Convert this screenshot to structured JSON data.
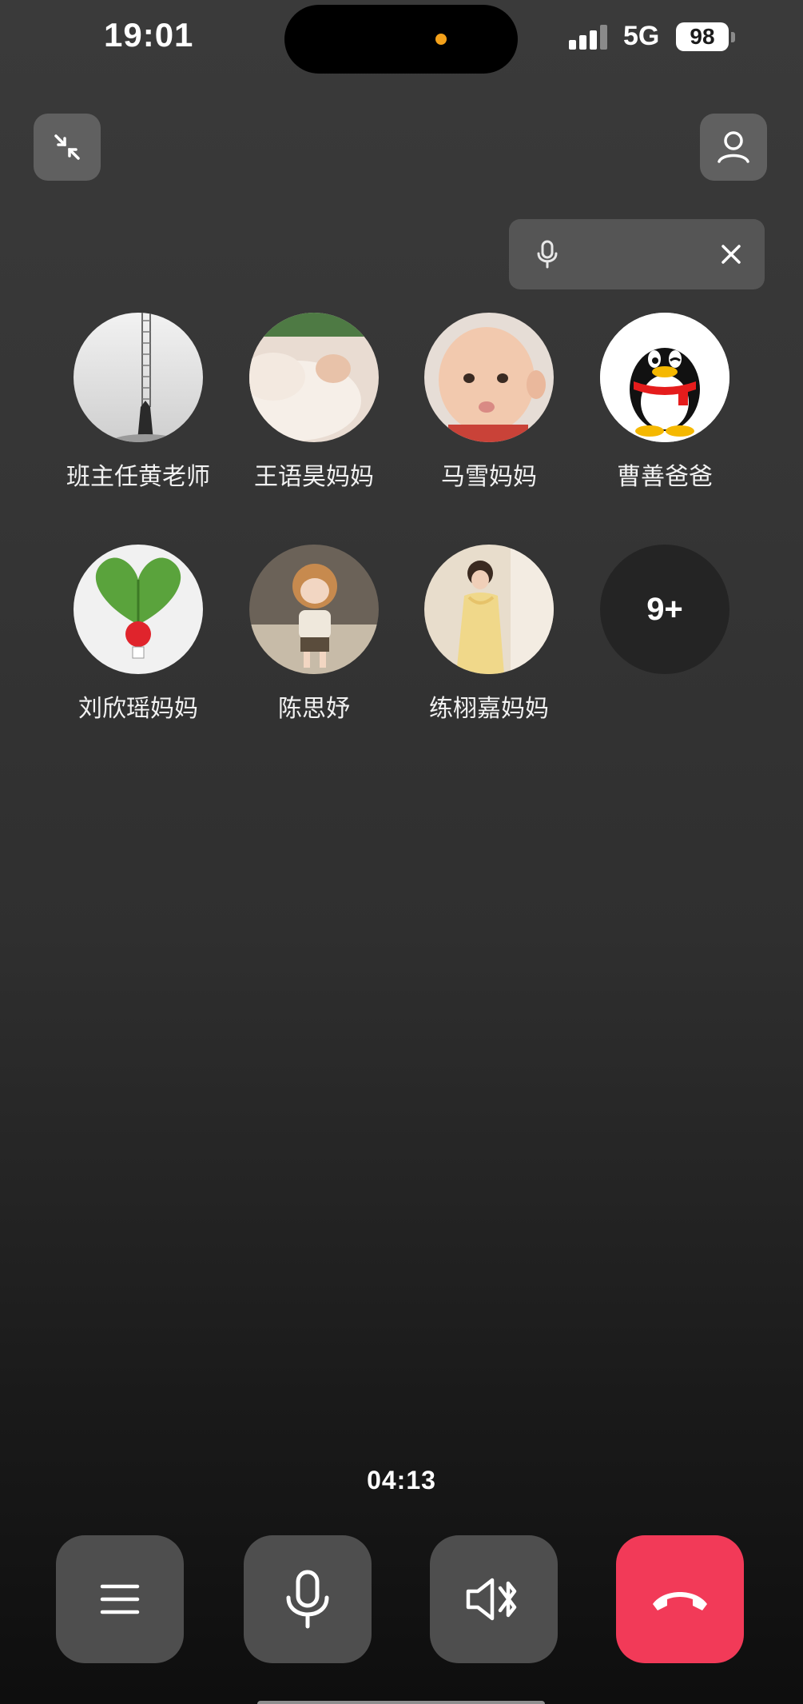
{
  "status_bar": {
    "time": "19:01",
    "network": "5G",
    "battery": "98"
  },
  "top_bar": {
    "minimize_icon": "collapse-arrows-icon",
    "profile_icon": "person-icon"
  },
  "speaking_indicator": {
    "mic_icon": "microphone-icon",
    "close_icon": "close-icon"
  },
  "participants": [
    {
      "name": "班主任黄老师",
      "avatar": "foggy-ladder-photo"
    },
    {
      "name": "王语昊妈妈",
      "avatar": "baby-blanket-photo"
    },
    {
      "name": "马雪妈妈",
      "avatar": "baby-face-photo"
    },
    {
      "name": "曹善爸爸",
      "avatar": "qq-penguin-logo"
    },
    {
      "name": "刘欣瑶妈妈",
      "avatar": "radish-heart-photo"
    },
    {
      "name": "陈思妤",
      "avatar": "doll-photo"
    },
    {
      "name": "练栩嘉妈妈",
      "avatar": "woman-dress-photo"
    }
  ],
  "more_participants": "9+",
  "call": {
    "duration": "04:13"
  },
  "controls": {
    "menu_icon": "menu-icon",
    "mic_icon": "microphone-icon",
    "speaker_icon": "speaker-bluetooth-icon",
    "hangup_icon": "hang-up-icon",
    "hangup_color": "#f23a58"
  }
}
